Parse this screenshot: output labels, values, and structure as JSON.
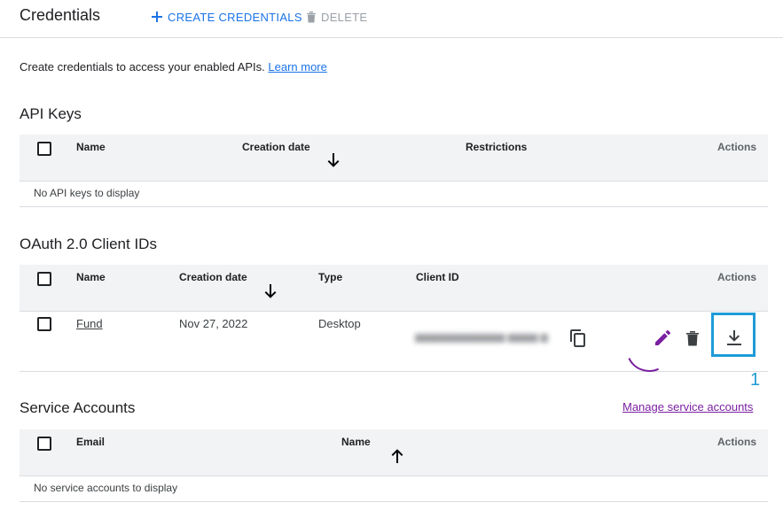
{
  "header": {
    "title": "Credentials",
    "create_label": "CREATE CREDENTIALS",
    "delete_label": "DELETE"
  },
  "intro": {
    "text": "Create credentials to access your enabled APIs.",
    "learn_more": "Learn more"
  },
  "api_keys": {
    "title": "API Keys",
    "columns": [
      "Name",
      "Creation date",
      "Restrictions",
      "Actions"
    ],
    "empty": "No API keys to display"
  },
  "oauth": {
    "title": "OAuth 2.0 Client IDs",
    "columns": [
      "Name",
      "Creation date",
      "Type",
      "Client ID",
      "Actions"
    ],
    "rows": [
      {
        "name": "Fund",
        "created": "Nov 27, 2022",
        "type": "Desktop"
      }
    ]
  },
  "service_accounts": {
    "title": "Service Accounts",
    "manage_link": "Manage service accounts",
    "columns": [
      "Email",
      "Name",
      "Actions"
    ],
    "empty": "No service accounts to display"
  },
  "annotation": {
    "callout_number": "1"
  },
  "colors": {
    "accent": "#1a73e8",
    "link_visited": "#7b1fa2",
    "highlight": "#1e9bd7"
  }
}
